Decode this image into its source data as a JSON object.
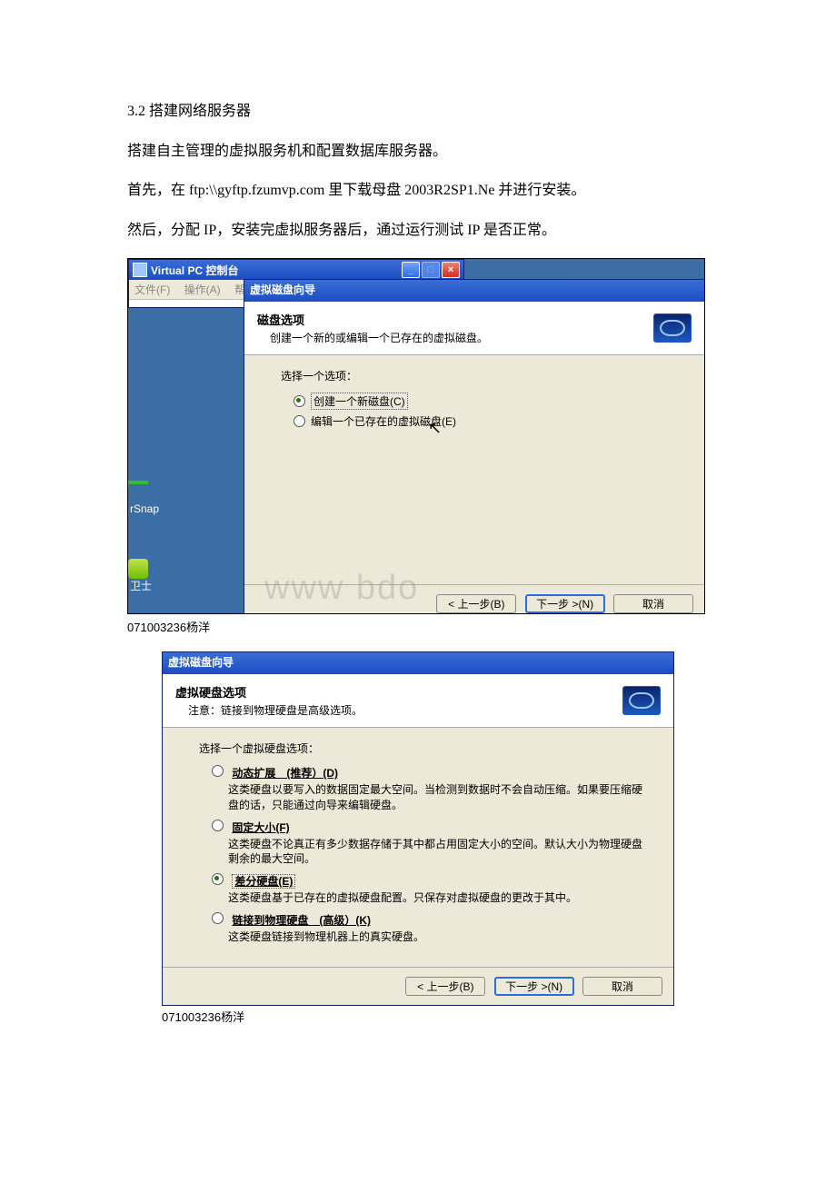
{
  "doc": {
    "h": "3.2 搭建网络服务器",
    "p1": "搭建自主管理的虚拟服务机和配置数据库服务器。",
    "p2": "首先，在 ftp:\\\\gyftp.fzumvp.com 里下载母盘 2003R2SP1.Ne 并进行安装。",
    "p3": "然后，分配 IP，安装完虚拟服务器后，通过运行测试 IP 是否正常。",
    "caption": "071003236杨洋"
  },
  "vpc": {
    "title": "Virtual PC 控制台",
    "menu_file": "文件(F)",
    "menu_action": "操作(A)",
    "menu_help": "帮",
    "desk_snap": "rSnap",
    "desk_guard": "卫士"
  },
  "wiz1": {
    "title": "虚拟磁盘向导",
    "header_bold": "磁盘选项",
    "header_sub": "创建一个新的或编辑一个已存在的虚拟磁盘。",
    "prompt": "选择一个选项：",
    "opt_create": "创建一个新磁盘(C)",
    "opt_edit": "编辑一个已存在的虚拟磁盘(E)",
    "btn_back": "< 上一步(B)",
    "btn_next": "下一步 >(N)",
    "btn_cancel": "取消",
    "watermark": "www bdo"
  },
  "wiz2": {
    "title": "虚拟磁盘向导",
    "header_bold": "虚拟硬盘选项",
    "header_sub": "注意：链接到物理硬盘是高级选项。",
    "prompt": "选择一个虚拟硬盘选项：",
    "opt1_label": "动态扩展　(推荐）(D)",
    "opt1_desc": "这类硬盘以要写入的数据固定最大空间。当检测到数据时不会自动压缩。如果要压缩硬盘的话，只能通过向导来编辑硬盘。",
    "opt2_label": "固定大小(F)",
    "opt2_desc": "这类硬盘不论真正有多少数据存储于其中都占用固定大小的空间。默认大小为物理硬盘剩余的最大空间。",
    "opt3_label": "差分硬盘(E)",
    "opt3_desc": "这类硬盘基于已存在的虚拟硬盘配置。只保存对虚拟硬盘的更改于其中。",
    "opt4_label": "链接到物理硬盘　(高级）(K)",
    "opt4_desc": "这类硬盘链接到物理机器上的真实硬盘。",
    "btn_back": "< 上一步(B)",
    "btn_next": "下一步 >(N)",
    "btn_cancel": "取消"
  }
}
